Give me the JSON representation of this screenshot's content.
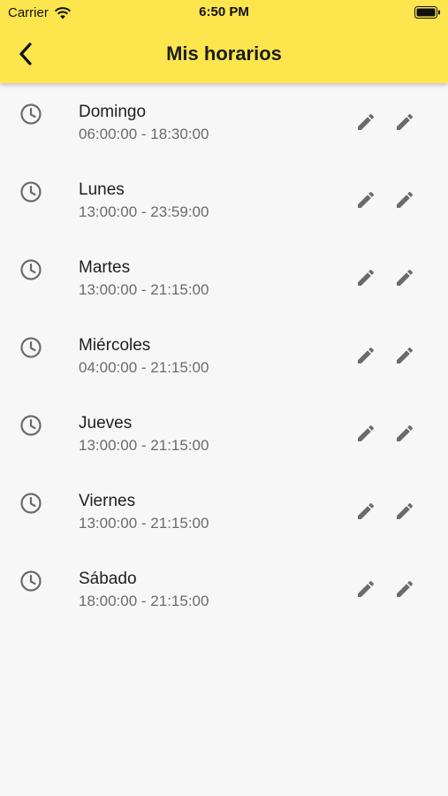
{
  "status_bar": {
    "carrier": "Carrier",
    "time": "6:50 PM"
  },
  "header": {
    "title": "Mis horarios",
    "back_icon": "chevron-left-icon"
  },
  "colors": {
    "accent": "#fde54d",
    "background": "#f7f7f7",
    "icon": "#6b6b6b"
  },
  "schedules": [
    {
      "day": "Domingo",
      "range": "06:00:00 - 18:30:00"
    },
    {
      "day": "Lunes",
      "range": "13:00:00 - 23:59:00"
    },
    {
      "day": "Martes",
      "range": "13:00:00 - 21:15:00"
    },
    {
      "day": "Miércoles",
      "range": "04:00:00 - 21:15:00"
    },
    {
      "day": "Jueves",
      "range": "13:00:00 - 21:15:00"
    },
    {
      "day": "Viernes",
      "range": "13:00:00 - 21:15:00"
    },
    {
      "day": "Sábado",
      "range": "18:00:00 - 21:15:00"
    }
  ]
}
